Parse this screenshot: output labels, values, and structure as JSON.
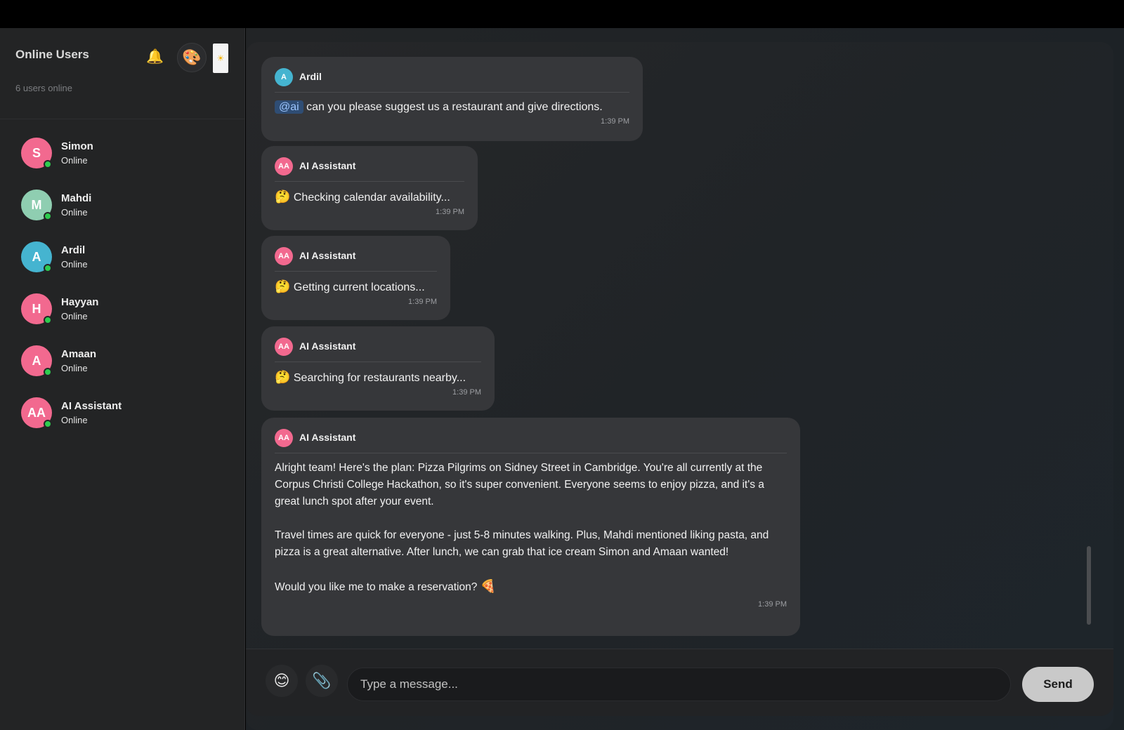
{
  "sidebar": {
    "title": "Online Users",
    "subtitle": "6 users online",
    "icons": {
      "notifications": "bell-icon",
      "theme_palette": "palette-icon",
      "theme_toggle": "sun-icon"
    },
    "users": [
      {
        "name": "Simon",
        "initials": "S",
        "status": "Online",
        "color": "#f2698f"
      },
      {
        "name": "Mahdi",
        "initials": "M",
        "status": "Online",
        "color": "#8fceb1"
      },
      {
        "name": "Ardil",
        "initials": "A",
        "status": "Online",
        "color": "#45b4d0"
      },
      {
        "name": "Hayyan",
        "initials": "H",
        "status": "Online",
        "color": "#f2698f"
      },
      {
        "name": "Amaan",
        "initials": "A",
        "status": "Online",
        "color": "#f2698f"
      },
      {
        "name": "AI Assistant",
        "initials": "AA",
        "status": "Online",
        "color": "#f2698f"
      }
    ]
  },
  "messages": [
    {
      "author": "Ardil",
      "initials": "A",
      "color": "#45b4d0",
      "mention": "@ai",
      "text": "can you please suggest us a restaurant and give directions.",
      "time": "1:39 PM"
    },
    {
      "author": "AI Assistant",
      "initials": "AA",
      "color": "#f2698f",
      "emoji": "🤔",
      "text": "Checking calendar availability...",
      "time": "1:39 PM"
    },
    {
      "author": "AI Assistant",
      "initials": "AA",
      "color": "#f2698f",
      "emoji": "🤔",
      "text": "Getting current locations...",
      "time": "1:39 PM"
    },
    {
      "author": "AI Assistant",
      "initials": "AA",
      "color": "#f2698f",
      "emoji": "🤔",
      "text": "Searching for restaurants nearby...",
      "time": "1:39 PM"
    },
    {
      "author": "AI Assistant",
      "initials": "AA",
      "color": "#f2698f",
      "paragraphs": [
        "Alright team! Here's the plan: Pizza Pilgrims on Sidney Street in Cambridge. You're all currently at the Corpus Christi College Hackathon, so it's super convenient. Everyone seems to enjoy pizza, and it's a great lunch spot after your event.",
        "Travel times are quick for everyone - just 5-8 minutes walking. Plus, Mahdi mentioned liking pasta, and pizza is a great alternative. After lunch, we can grab that ice cream Simon and Amaan wanted!",
        "Would you like me to make a reservation?"
      ],
      "trailing_emoji": "🍕",
      "time": "1:39 PM"
    }
  ],
  "composer": {
    "emoji_icon": "smiley-icon",
    "attach_icon": "paperclip-icon",
    "placeholder": "Type a message...",
    "send_label": "Send"
  }
}
